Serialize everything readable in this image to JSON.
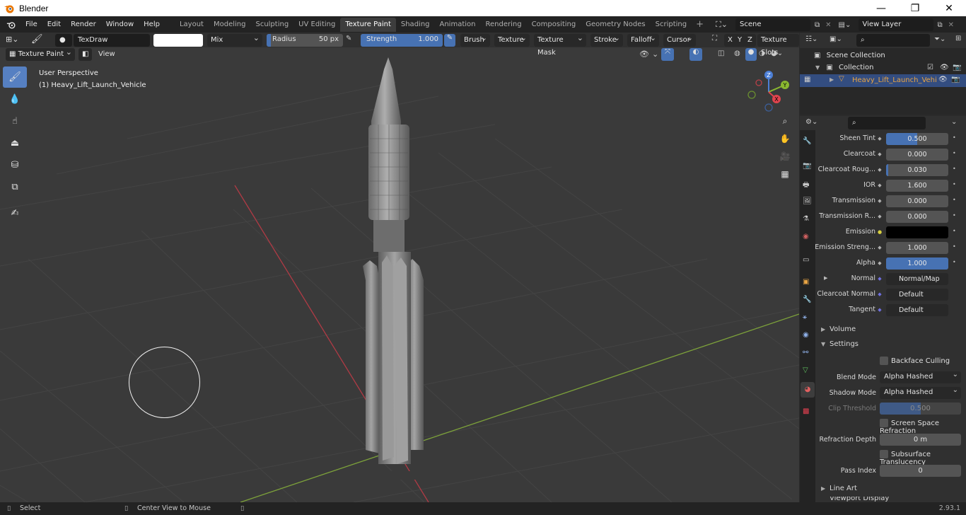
{
  "window": {
    "title": "Blender",
    "version": "2.93.1"
  },
  "menu": [
    "File",
    "Edit",
    "Render",
    "Window",
    "Help"
  ],
  "workspaces": [
    "Layout",
    "Modeling",
    "Sculpting",
    "UV Editing",
    "Texture Paint",
    "Shading",
    "Animation",
    "Rendering",
    "Compositing",
    "Geometry Nodes",
    "Scripting"
  ],
  "active_workspace": "Texture Paint",
  "scene": {
    "name": "Scene",
    "view_layer": "View Layer"
  },
  "tool_header": {
    "brush_name": "TexDraw",
    "blend_mode": "Mix",
    "radius_label": "Radius",
    "radius_value": "50 px",
    "strength_label": "Strength",
    "strength_value": "1.000",
    "strength_fraction": 1.0,
    "dropdowns": [
      "Brush",
      "Texture",
      "Texture Mask",
      "Stroke",
      "Falloff",
      "Cursor"
    ],
    "axes": [
      "X",
      "Y",
      "Z"
    ],
    "texture_slots": "Texture Slots"
  },
  "view_header": {
    "mode": "Texture Paint",
    "view": "View"
  },
  "viewport": {
    "perspective": "User Perspective",
    "object": "(1) Heavy_Lift_Launch_Vehicle"
  },
  "gizmo": {
    "z": "Z",
    "y": "Y",
    "x": "X"
  },
  "outliner": {
    "root": "Scene Collection",
    "collection": "Collection",
    "object": "Heavy_Lift_Launch_Vehi"
  },
  "properties": {
    "rows": [
      {
        "label": "Sheen Tint",
        "value": "0.500",
        "fill": 0.5,
        "dot": "◆"
      },
      {
        "label": "Clearcoat",
        "value": "0.000",
        "fill": 0,
        "dot": "◆"
      },
      {
        "label": "Clearcoat Roug...",
        "value": "0.030",
        "fill": 0.03,
        "dot": "◆"
      },
      {
        "label": "IOR",
        "value": "1.600",
        "fill": 0,
        "dot": "◆"
      },
      {
        "label": "Transmission",
        "value": "0.000",
        "fill": 0,
        "dot": "◆"
      },
      {
        "label": "Transmission R...",
        "value": "0.000",
        "fill": 0,
        "dot": "◆"
      },
      {
        "label": "Emission",
        "value": "",
        "fill": 0,
        "dot": "●"
      },
      {
        "label": "Emission Streng...",
        "value": "1.000",
        "fill": 0,
        "dot": "◆"
      },
      {
        "label": "Alpha",
        "value": "1.000",
        "fill": 1.0,
        "dot": "◆"
      },
      {
        "label": "Normal",
        "value": "Normal/Map",
        "fill": 0,
        "dot": "◆"
      },
      {
        "label": "Clearcoat Normal",
        "value": "Default",
        "fill": 0,
        "dot": "◆"
      },
      {
        "label": "Tangent",
        "value": "Default",
        "fill": 0,
        "dot": "◆"
      }
    ],
    "volume": "Volume",
    "settings": "Settings",
    "backface_culling": "Backface Culling",
    "blend_mode_label": "Blend Mode",
    "blend_mode_value": "Alpha Hashed",
    "shadow_mode_label": "Shadow Mode",
    "shadow_mode_value": "Alpha Hashed",
    "clip_threshold_label": "Clip Threshold",
    "clip_threshold_value": "0.500",
    "clip_threshold_fill": 0.5,
    "ssr": "Screen Space Refraction",
    "refraction_depth_label": "Refraction Depth",
    "refraction_depth_value": "0 m",
    "subsurface": "Subsurface Translucency",
    "pass_index_label": "Pass Index",
    "pass_index_value": "0",
    "line_art": "Line Art",
    "viewport_display": "Viewport Display"
  },
  "status": {
    "select": "Select",
    "center": "Center View to Mouse"
  },
  "colors": {
    "accent": "#4772b3",
    "active_tool": "#5680c2",
    "selected_object": "#e8a444"
  }
}
